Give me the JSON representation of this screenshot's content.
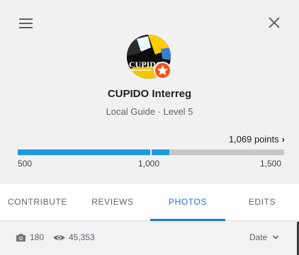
{
  "profile": {
    "name": "CUPIDO Interreg",
    "subtitle": "Local Guide · Level 5",
    "avatar_text": "CUPIDO"
  },
  "progress": {
    "points_label": "1,069 points",
    "points_value": 1069,
    "scale_min_label": "500",
    "scale_mid_label": "1,000",
    "scale_max_label": "1,500",
    "fill_fraction": 0.569
  },
  "tabs": [
    {
      "label": "CONTRIBUTE",
      "active": false
    },
    {
      "label": "REVIEWS",
      "active": false
    },
    {
      "label": "PHOTOS",
      "active": true
    },
    {
      "label": "EDITS",
      "active": false
    }
  ],
  "stats": {
    "photo_count": "180",
    "view_count": "45,353",
    "sort_label": "Date"
  },
  "icons": {
    "menu": "menu-icon",
    "close": "close-icon",
    "camera": "camera-icon",
    "views": "eye-icon",
    "sort": "chevron-down-icon",
    "badge": "star-icon",
    "points_chevron": "chevron-right-icon"
  },
  "colors": {
    "accent": "#1a73e8",
    "progress_fill": "#1e9ae0",
    "progress_track": "#c6c6c6",
    "badge": "#f4511e"
  }
}
